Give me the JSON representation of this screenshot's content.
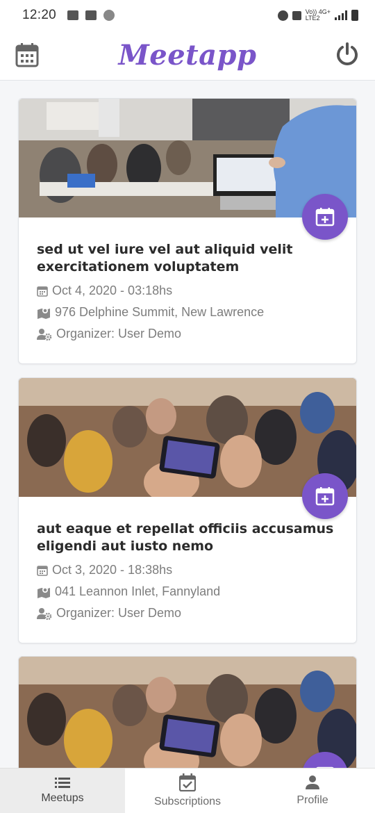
{
  "status_bar": {
    "time": "12:20",
    "network_top": "Vo)) 4G+",
    "network_bottom": "LTE2"
  },
  "header": {
    "logo_text": "Meetapp",
    "left_icon": "calendar-icon",
    "right_icon": "power-icon"
  },
  "colors": {
    "brand": "#7a55c9",
    "muted_text": "#7d7d7d"
  },
  "meetups": [
    {
      "title": "sed ut vel iure vel aut aliquid velit exercitationem voluptatem",
      "date": "Oct 4, 2020 - 03:18hs",
      "location": "976 Delphine Summit, New Lawrence",
      "organizer": "Organizer: User Demo",
      "image": "conference-room-presentation-photo"
    },
    {
      "title": "aut eaque et repellat officiis accusamus eligendi aut iusto nemo",
      "date": "Oct 3, 2020 - 18:38hs",
      "location": "041 Leannon Inlet, Fannyland",
      "organizer": "Organizer: User Demo",
      "image": "audience-phone-recording-photo"
    },
    {
      "title": "",
      "date": "",
      "location": "",
      "organizer": "",
      "image": "audience-phone-recording-photo"
    }
  ],
  "bottom_nav": {
    "tabs": [
      {
        "label": "Meetups",
        "icon": "list-icon",
        "active": true
      },
      {
        "label": "Subscriptions",
        "icon": "calendar-check-icon",
        "active": false
      },
      {
        "label": "Profile",
        "icon": "person-icon",
        "active": false
      }
    ]
  }
}
